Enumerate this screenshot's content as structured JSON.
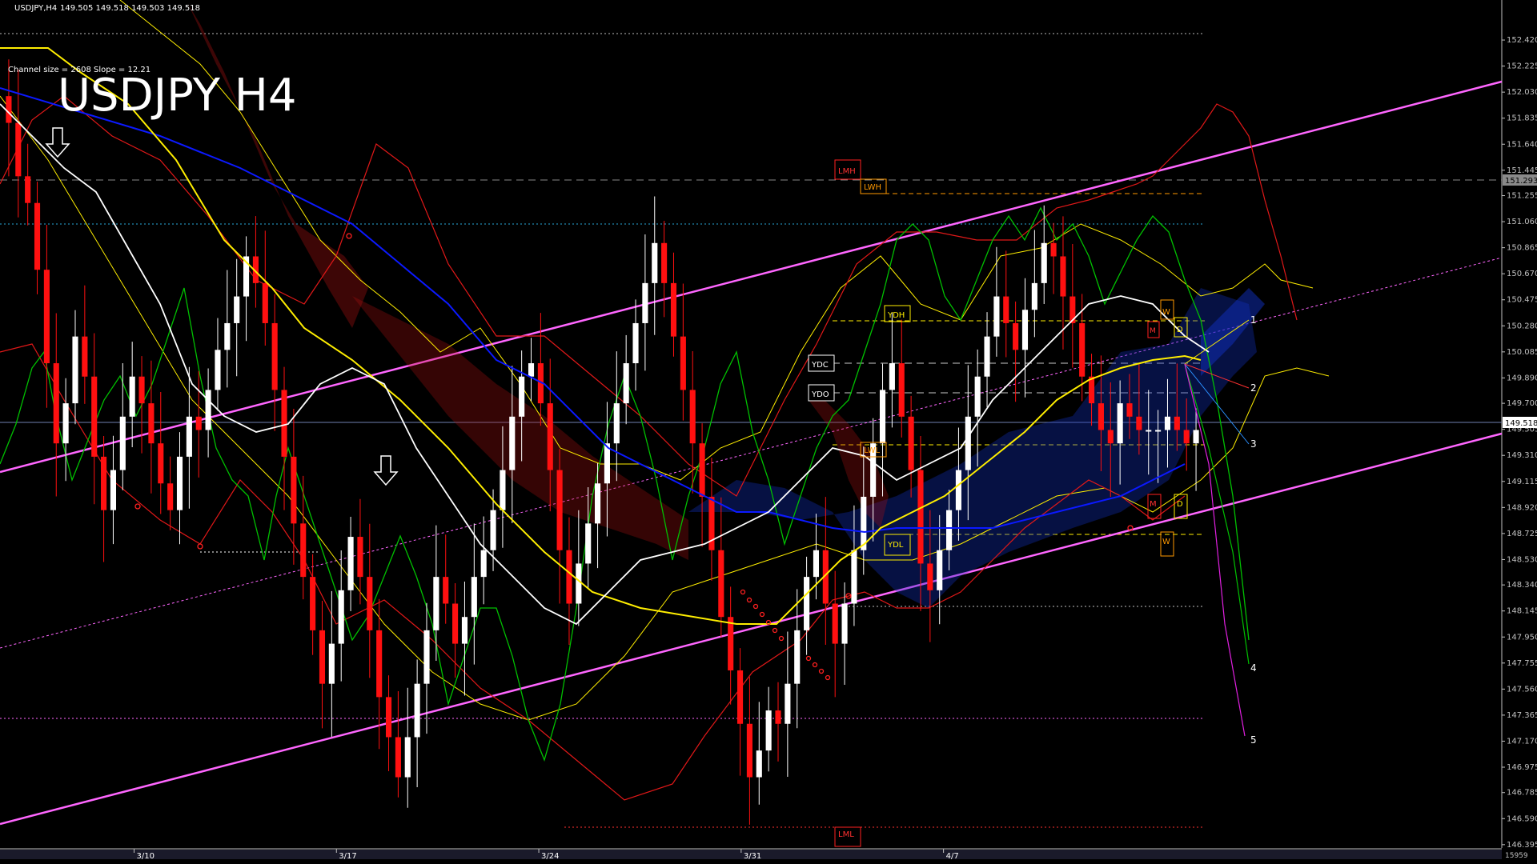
{
  "header": {
    "symbol_text": "USDJPY,H4",
    "quote_text": "149.505 149.518 149.503 149.518",
    "channel_info": "Channel size = 2608 Slope = 12.21",
    "big_title": "USDJPY H4"
  },
  "current_price": "149.518",
  "marked_price": "151.293",
  "footer_label": "15959",
  "colors": {
    "background": "#000000",
    "bull_candle": "#ffffff",
    "bear_candle": "#ff1010",
    "channel": "#ff66ff",
    "ma_yellow": "#ffee00",
    "ma_blue": "#0010ff",
    "ma_white": "#ffffff",
    "oscillator": "#00c000"
  },
  "icons": [
    "down-arrow-icon",
    "down-arrow-icon"
  ],
  "chart_data": {
    "type": "candlestick",
    "title": "USDJPY H4",
    "ylim": [
      146.4,
      152.6
    ],
    "y_ticks": [
      "152.420",
      "152.225",
      "152.030",
      "151.835",
      "151.640",
      "151.445",
      "151.255",
      "151.060",
      "150.865",
      "150.670",
      "150.475",
      "150.280",
      "150.085",
      "149.890",
      "149.700",
      "149.505",
      "149.310",
      "149.115",
      "148.920",
      "148.725",
      "148.530",
      "148.340",
      "148.145",
      "147.950",
      "147.755",
      "147.560",
      "147.365",
      "147.170",
      "146.975",
      "146.785",
      "146.590",
      "146.395"
    ],
    "x_ticks": [
      {
        "label": "3/10",
        "index": 22
      },
      {
        "label": "3/17",
        "index": 57
      },
      {
        "label": "3/24",
        "index": 92
      },
      {
        "label": "3/31",
        "index": 127
      },
      {
        "label": "4/7",
        "index": 162
      }
    ],
    "n_slots": 207,
    "closes": [
      151.8,
      151.4,
      151.2,
      150.7,
      150.0,
      149.4,
      149.7,
      150.2,
      149.9,
      149.3,
      148.9,
      149.2,
      149.6,
      149.9,
      149.7,
      149.4,
      149.1,
      148.9,
      149.3,
      149.6,
      149.5,
      149.8,
      150.1,
      150.3,
      150.5,
      150.8,
      150.6,
      150.3,
      149.8,
      149.3,
      148.8,
      148.4,
      148.0,
      147.6,
      147.9,
      148.3,
      148.7,
      148.4,
      148.0,
      147.5,
      147.2,
      146.9,
      147.2,
      147.6,
      148.0,
      148.4,
      148.2,
      147.9,
      148.1,
      148.4,
      148.6,
      148.9,
      149.2,
      149.6,
      149.9,
      150.0,
      149.7,
      149.2,
      148.6,
      148.2,
      148.5,
      148.8,
      149.1,
      149.4,
      149.7,
      150.0,
      150.3,
      150.6,
      150.9,
      150.6,
      150.2,
      149.8,
      149.4,
      149.0,
      148.6,
      148.1,
      147.7,
      147.3,
      146.9,
      147.1,
      147.4,
      147.3,
      147.6,
      148.0,
      148.4,
      148.6,
      148.2,
      147.9,
      148.2,
      148.6,
      149.0,
      149.4,
      149.8,
      150.0,
      149.6,
      149.2,
      148.5,
      148.3,
      148.6,
      148.9,
      149.2,
      149.6,
      149.9,
      150.2,
      150.5,
      150.3,
      150.1,
      150.4,
      150.6,
      150.9,
      150.8,
      150.5,
      150.3,
      149.9,
      149.7,
      149.5,
      149.4,
      149.7,
      149.6,
      149.5,
      149.5,
      149.5,
      149.6,
      149.5,
      149.4,
      149.5
    ],
    "series_labels": [
      "1",
      "2",
      "3",
      "4",
      "5"
    ],
    "level_labels": [
      "LMH",
      "LWH",
      "YDH",
      "YDC",
      "YDO",
      "LWL",
      "YDL",
      "LML",
      "W",
      "D",
      "M",
      "D",
      "M",
      "W"
    ]
  }
}
